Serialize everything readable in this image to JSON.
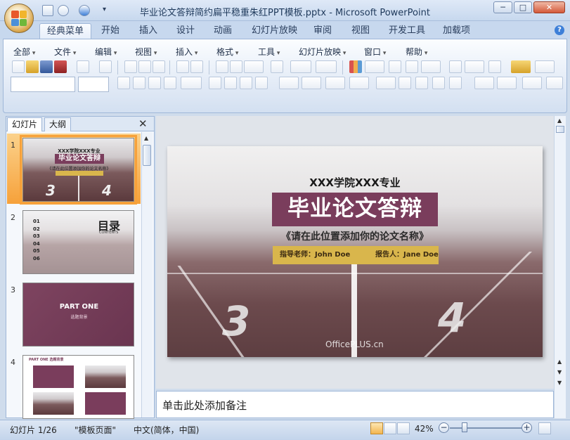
{
  "window": {
    "title": "毕业论文答辩简约扁平稳重朱红PPT模板.pptx - Microsoft PowerPoint",
    "min_label": "─",
    "max_label": "□",
    "close_label": "✕"
  },
  "ribbon_tabs": [
    "经典菜单",
    "开始",
    "插入",
    "设计",
    "动画",
    "幻灯片放映",
    "审阅",
    "视图",
    "开发工具",
    "加载项"
  ],
  "active_tab": "经典菜单",
  "classic_menu": [
    "全部",
    "文件",
    "编辑",
    "视图",
    "插入",
    "格式",
    "工具",
    "幻灯片放映",
    "窗口",
    "帮助"
  ],
  "help_label": "?",
  "pane": {
    "tabs": [
      "幻灯片",
      "大纲"
    ],
    "close_label": "✕",
    "slides": [
      {
        "num": "1",
        "kicker": "XXX学院XXX专业",
        "title": "毕业论文答辩",
        "tag": "《请在此位置添加你的论文名称》"
      },
      {
        "num": "2",
        "title": "目录",
        "subtitle": "CONTENTS",
        "items": [
          "01",
          "02",
          "03",
          "04",
          "05",
          "06"
        ]
      },
      {
        "num": "3",
        "title": "PART ONE",
        "subtitle": "选题背景"
      },
      {
        "num": "4",
        "title": "PART ONE 选题背景"
      }
    ]
  },
  "slide": {
    "subtitle": "XXX学院XXX专业",
    "title": "毕业论文答辩",
    "tagline": "《请在此位置添加你的论文名称》",
    "advisor": "指导老师：John Doe",
    "reporter": "报告人：Jane Doe",
    "lane_left": "3",
    "lane_right": "4",
    "watermark": "OfficePLUS.cn"
  },
  "notes": {
    "placeholder": "单击此处添加备注"
  },
  "status": {
    "slide_counter": "幻灯片 1/26",
    "theme": "\"模板页面\"",
    "language": "中文(简体，中国)",
    "zoom": "42%",
    "zoom_minus": "−",
    "zoom_plus": "+"
  },
  "colors": {
    "title_block": "#7a3d5c",
    "info_bar": "#d9b64c",
    "selection": "#f6a13a"
  }
}
